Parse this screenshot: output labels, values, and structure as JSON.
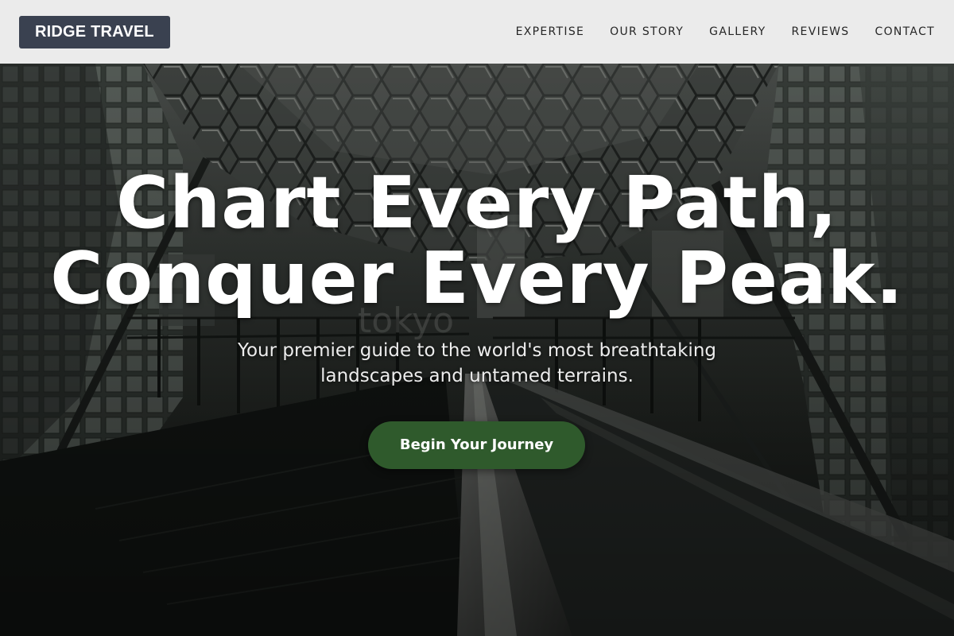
{
  "header": {
    "brand": "RIDGE TRAVEL",
    "nav": [
      {
        "label": "EXPERTISE"
      },
      {
        "label": "OUR STORY"
      },
      {
        "label": "GALLERY"
      },
      {
        "label": "REVIEWS"
      },
      {
        "label": "CONTACT"
      }
    ]
  },
  "hero": {
    "title_lines": [
      "Chart Every Path,",
      "Conquer Every Peak."
    ],
    "subtitle_lines": [
      "Your premier guide to the world's most breathtaking",
      "landscapes and untamed terrains."
    ],
    "cta_label": "Begin Your Journey",
    "background_watermark": "tokyo"
  },
  "colors": {
    "header_bg": "#ebebeb",
    "brand_bg": "#3a4150",
    "cta_bg": "#2f5a2c",
    "text_light": "#ffffff"
  }
}
